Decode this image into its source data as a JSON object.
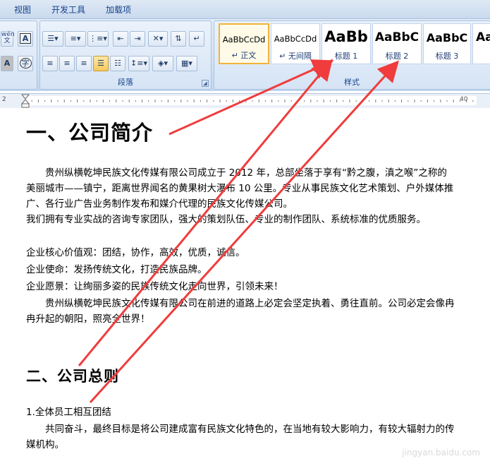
{
  "menu": {
    "view": "视图",
    "developer": "开发工具",
    "addins": "加载项"
  },
  "paragraph_group": {
    "label": "段落"
  },
  "styles_group": {
    "label": "样式",
    "items": [
      {
        "sample": "AaBbCcDd",
        "name": "↵ 正文",
        "selected": true
      },
      {
        "sample": "AaBbCcDd",
        "name": "↵ 无间隔"
      },
      {
        "sample": "AaBb",
        "name": "标题 1"
      },
      {
        "sample": "AaBbC",
        "name": "标题 2"
      },
      {
        "sample": "AaBbC",
        "name": "标题 3"
      },
      {
        "sample": "Aa",
        "name": ""
      }
    ]
  },
  "font_buttons": {
    "wen": "wén\n文",
    "a_box": "A",
    "a_shade": "A",
    "zi_circle": "字"
  },
  "ruler": {
    "left_label": "2",
    "right_label": "40"
  },
  "document": {
    "heading1": "一、公司简介",
    "p1": "贵州纵横乾坤民族文化传媒有限公司成立于 2012 年，总部坐落于享有“黔之腹，滇之喉”之称的美丽城市——镇宁，距离世界闻名的黄果树大瀑布 10 公里。专业从事民族文化艺术策划、户外媒体推广、各行业广告业务制作发布和媒介代理的民族文化传媒公司。",
    "p2": "我们拥有专业实战的咨询专家团队，强大的策划队伍、专业的制作团队、系统标准的优质服务。",
    "p3": "企业核心价值观：团结，协作，高效，优质，诚信。",
    "p4": "企业使命：发扬传统文化，打造民族品牌。",
    "p5": "企业愿景：让绚丽多姿的民族传统文化走向世界，引领未来！",
    "p6": "贵州纵横乾坤民族文化传媒有限公司在前进的道路上必定会坚定执着、勇往直前。公司必定会像冉冉升起的朝阳，照亮全世界！",
    "heading2": "二、公司总则",
    "item1": "1.全体员工相互团结",
    "p7": "共同奋斗，最终目标是将公司建成富有民族文化特色的，在当地有较大影响力，有较大辐射力的传媒机构。"
  },
  "watermark": "jingyan.baidu.com",
  "colors": {
    "arrow": "#f03c3c",
    "ribbon_text": "#15428b"
  }
}
